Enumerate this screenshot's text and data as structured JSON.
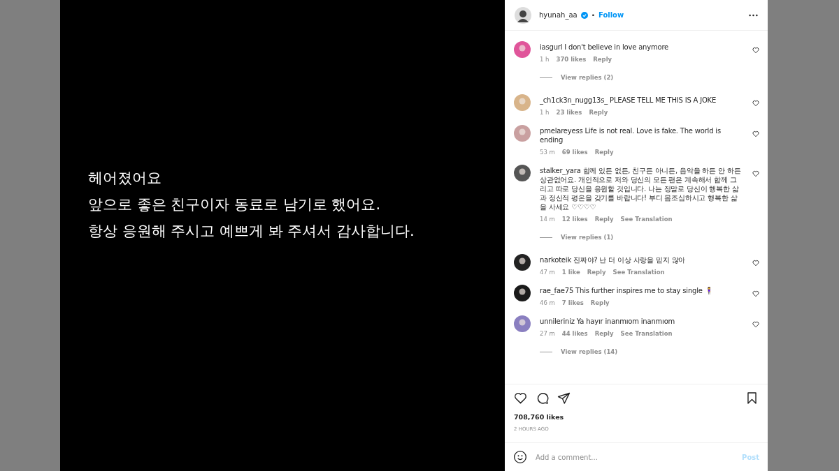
{
  "post": {
    "lines": [
      "헤어졌어요",
      "앞으로 좋은 친구이자 동료로 남기로 했어요.",
      "항상 응원해 주시고 예쁘게 봐 주셔서 감사합니다."
    ]
  },
  "header": {
    "username": "hyunah_aa",
    "verified": true,
    "separator": "•",
    "follow": "Follow"
  },
  "comments": [
    {
      "user": "iasgurl",
      "text": "I don't believe in love anymore",
      "time": "1 h",
      "likes": "370 likes",
      "reply": "Reply",
      "replies": "View replies (2)"
    },
    {
      "user": "_ch1ck3n_nugg13s_",
      "text": "PLEASE TELL ME THIS IS A JOKE",
      "time": "1 h",
      "likes": "23 likes",
      "reply": "Reply"
    },
    {
      "user": "pmelareyess",
      "text": "Life is not real. Love is fake. The world is ending",
      "time": "53 m",
      "likes": "69 likes",
      "reply": "Reply"
    },
    {
      "user": "stalker_yara",
      "text": "함께 있든 없든, 친구든 아니든, 음악을 하든 안 하든 상관없어요. 개인적으로 저와 당신의 모든 팬은 계속해서 함께 그리고 따로 당신을 응원할 것입니다. 나는 정말로 당신이 행복한 삶과 정신적 평온을 갖기를 바랍니다! 부디 몸조심하시고 행복한 삶을 사세요 ♡♡♡♡",
      "time": "14 m",
      "likes": "12 likes",
      "reply": "Reply",
      "translate": "See Translation",
      "replies": "View replies (1)"
    },
    {
      "user": "narkoteik",
      "text": "진짜야? 난 더 이상 사랑을 믿지 않아",
      "time": "47 m",
      "likes": "1 like",
      "reply": "Reply",
      "translate": "See Translation"
    },
    {
      "user": "rae_fae75",
      "text": "This further inspires me to stay single 🧍‍♀️",
      "time": "46 m",
      "likes": "7 likes",
      "reply": "Reply"
    },
    {
      "user": "unnileriniz",
      "text": "Ya hayır inanmıom inanmıom",
      "time": "27 m",
      "likes": "44 likes",
      "reply": "Reply",
      "translate": "See Translation",
      "replies": "View replies (14)"
    }
  ],
  "footer": {
    "likes": "708,760 likes",
    "time": "2 HOURS AGO",
    "comment_placeholder": "Add a comment...",
    "post": "Post"
  }
}
